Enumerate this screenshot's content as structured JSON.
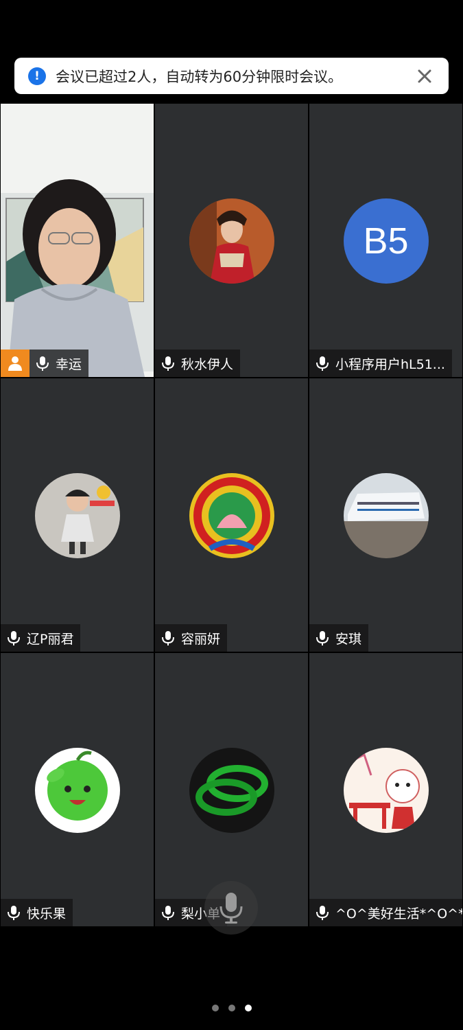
{
  "notice": {
    "text": "会议已超过2人，自动转为60分钟限时会议。",
    "icon": "info-icon"
  },
  "participants": [
    {
      "name": "幸运",
      "type": "video",
      "host": true
    },
    {
      "name": "秋水伊人",
      "type": "avatar"
    },
    {
      "name": "小程序用户hL51...",
      "type": "initials",
      "initials": "B5",
      "color": "#3a6fd1"
    },
    {
      "name": "辽P丽君",
      "type": "avatar"
    },
    {
      "name": "容丽妍",
      "type": "avatar"
    },
    {
      "name": "安琪",
      "type": "avatar"
    },
    {
      "name": "快乐果",
      "type": "avatar"
    },
    {
      "name": "梨小单",
      "type": "avatar"
    },
    {
      "name": "^O^美好生活*^O^*",
      "type": "avatar"
    }
  ],
  "pagination": {
    "total": 3,
    "active": 3
  },
  "colors": {
    "accent": "#1a73e8",
    "host_badge": "#f08a1f",
    "tile_bg": "#2d2f31"
  }
}
